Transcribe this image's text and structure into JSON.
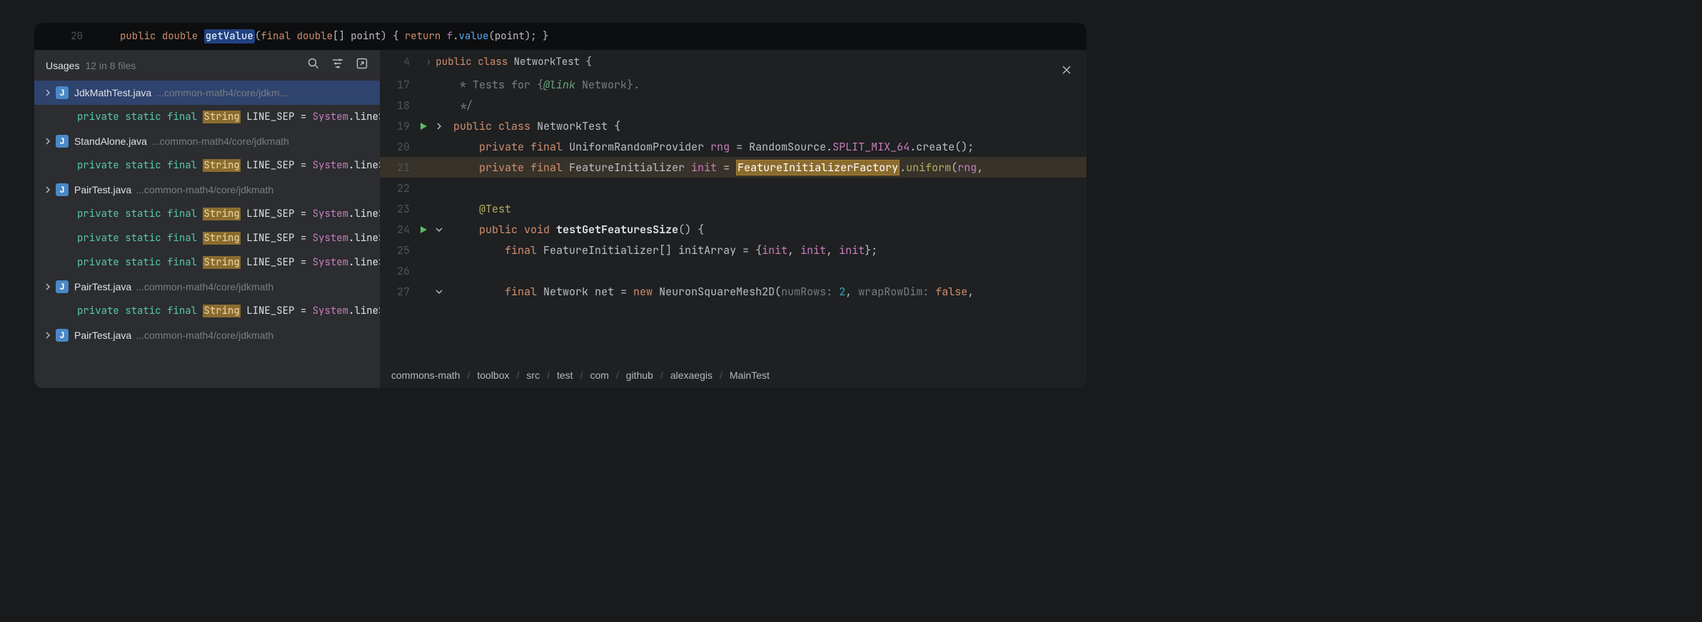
{
  "topLine": {
    "number": "20",
    "tokens": [
      {
        "t": "public",
        "c": "kw"
      },
      {
        "t": " "
      },
      {
        "t": "double",
        "c": "kw"
      },
      {
        "t": " "
      },
      {
        "t": "getValue",
        "c": "hl-blue"
      },
      {
        "t": "(",
        "c": "punc"
      },
      {
        "t": "final",
        "c": "kw"
      },
      {
        "t": " "
      },
      {
        "t": "double",
        "c": "kw"
      },
      {
        "t": "[] ",
        "c": "punc"
      },
      {
        "t": "point",
        "c": "ident"
      },
      {
        "t": ") { ",
        "c": "punc"
      },
      {
        "t": "return",
        "c": "kw"
      },
      {
        "t": " "
      },
      {
        "t": "f",
        "c": "type"
      },
      {
        "t": ".",
        "c": "punc"
      },
      {
        "t": "value",
        "c": "method-call"
      },
      {
        "t": "(",
        "c": "punc"
      },
      {
        "t": "point",
        "c": "ident"
      },
      {
        "t": "); }",
        "c": "punc"
      }
    ]
  },
  "usages": {
    "title": "Usages",
    "count": "12 in 8 files",
    "items": [
      {
        "kind": "file",
        "indent": 12,
        "chevron": true,
        "selected": true,
        "name": "JdkMathTest.java",
        "path": "...common-math4/core/jdkm..."
      },
      {
        "kind": "code",
        "indent": 60,
        "tokens": [
          {
            "t": "private ",
            "c": "cs-kw-pv"
          },
          {
            "t": "static ",
            "c": "cs-kw-pv"
          },
          {
            "t": "final ",
            "c": "cs-kw-pv"
          },
          {
            "t": "String",
            "c": "hl-amber"
          },
          {
            "t": " LINE_SEP ",
            "c": "cs-id"
          },
          {
            "t": "= ",
            "c": "cs-id"
          },
          {
            "t": "System",
            "c": "cs-type"
          },
          {
            "t": ".",
            "c": "cs-id"
          },
          {
            "t": "lineS",
            "c": "cs-id"
          }
        ]
      },
      {
        "kind": "file",
        "indent": 12,
        "chevron": true,
        "name": "StandAlone.java",
        "path": "...common-math4/core/jdkmath"
      },
      {
        "kind": "code",
        "indent": 60,
        "tokens": [
          {
            "t": "private ",
            "c": "cs-kw-pv"
          },
          {
            "t": "static ",
            "c": "cs-kw-pv"
          },
          {
            "t": "final ",
            "c": "cs-kw-pv"
          },
          {
            "t": "String",
            "c": "hl-amber"
          },
          {
            "t": " LINE_SEP ",
            "c": "cs-id"
          },
          {
            "t": "= ",
            "c": "cs-id"
          },
          {
            "t": "System",
            "c": "cs-type"
          },
          {
            "t": ".",
            "c": "cs-id"
          },
          {
            "t": "lineS",
            "c": "cs-id"
          }
        ]
      },
      {
        "kind": "file",
        "indent": 12,
        "chevron": true,
        "name": "PairTest.java",
        "path": "...common-math4/core/jdkmath"
      },
      {
        "kind": "code",
        "indent": 60,
        "tokens": [
          {
            "t": "private ",
            "c": "cs-kw-pv"
          },
          {
            "t": "static ",
            "c": "cs-kw-pv"
          },
          {
            "t": "final ",
            "c": "cs-kw-pv"
          },
          {
            "t": "String",
            "c": "hl-amber"
          },
          {
            "t": " LINE_SEP ",
            "c": "cs-id"
          },
          {
            "t": "= ",
            "c": "cs-id"
          },
          {
            "t": "System",
            "c": "cs-type"
          },
          {
            "t": ".",
            "c": "cs-id"
          },
          {
            "t": "lineS",
            "c": "cs-id"
          }
        ]
      },
      {
        "kind": "code",
        "indent": 60,
        "tokens": [
          {
            "t": "private ",
            "c": "cs-kw-pv"
          },
          {
            "t": "static ",
            "c": "cs-kw-pv"
          },
          {
            "t": "final ",
            "c": "cs-kw-pv"
          },
          {
            "t": "String",
            "c": "hl-amber"
          },
          {
            "t": " LINE_SEP ",
            "c": "cs-id"
          },
          {
            "t": "= ",
            "c": "cs-id"
          },
          {
            "t": "System",
            "c": "cs-type"
          },
          {
            "t": ".",
            "c": "cs-id"
          },
          {
            "t": "lineS",
            "c": "cs-id"
          }
        ]
      },
      {
        "kind": "code",
        "indent": 60,
        "tokens": [
          {
            "t": "private ",
            "c": "cs-kw-pv"
          },
          {
            "t": "static ",
            "c": "cs-kw-pv"
          },
          {
            "t": "final ",
            "c": "cs-kw-pv"
          },
          {
            "t": "String",
            "c": "hl-amber"
          },
          {
            "t": " LINE_SEP ",
            "c": "cs-id"
          },
          {
            "t": "= ",
            "c": "cs-id"
          },
          {
            "t": "System",
            "c": "cs-type"
          },
          {
            "t": ".",
            "c": "cs-id"
          },
          {
            "t": "lineS",
            "c": "cs-id"
          }
        ]
      },
      {
        "kind": "file",
        "indent": 12,
        "chevron": true,
        "name": "PairTest.java",
        "path": "...common-math4/core/jdkmath"
      },
      {
        "kind": "code",
        "indent": 60,
        "tokens": [
          {
            "t": "private ",
            "c": "cs-kw-pv"
          },
          {
            "t": "static ",
            "c": "cs-kw-pv"
          },
          {
            "t": "final ",
            "c": "cs-kw-pv"
          },
          {
            "t": "String",
            "c": "hl-amber"
          },
          {
            "t": " LINE_SEP ",
            "c": "cs-id"
          },
          {
            "t": "= ",
            "c": "cs-id"
          },
          {
            "t": "System",
            "c": "cs-type"
          },
          {
            "t": ".",
            "c": "cs-id"
          },
          {
            "t": "lineS",
            "c": "cs-id"
          }
        ]
      },
      {
        "kind": "file",
        "indent": 12,
        "chevron": true,
        "name": "PairTest.java",
        "path": "...common-math4/core/jdkmath"
      }
    ]
  },
  "preview": {
    "crumbTop": {
      "ln": "4",
      "text": "public class NetworkTest {"
    },
    "lines": [
      {
        "ln": "17",
        "run": "",
        "fold": "",
        "tokens": [
          {
            "t": "  * Tests for {",
            "c": "comment"
          },
          {
            "t": "@link",
            "c": "doc-tag"
          },
          {
            "t": " ",
            "c": "comment"
          },
          {
            "t": "Network",
            "c": "comment"
          },
          {
            "t": "}.",
            "c": "comment"
          }
        ]
      },
      {
        "ln": "18",
        "run": "",
        "fold": "",
        "tokens": [
          {
            "t": "  */",
            "c": "comment"
          }
        ]
      },
      {
        "ln": "19",
        "run": "play",
        "fold": "right",
        "tokens": [
          {
            "t": " ",
            "c": ""
          },
          {
            "t": "public",
            "c": "kw"
          },
          {
            "t": " ",
            "c": ""
          },
          {
            "t": "class",
            "c": "kw"
          },
          {
            "t": " ",
            "c": ""
          },
          {
            "t": "NetworkTest",
            "c": "ident"
          },
          {
            "t": " {",
            "c": "punc"
          }
        ]
      },
      {
        "ln": "20",
        "run": "",
        "fold": "",
        "tokens": [
          {
            "t": "     ",
            "c": ""
          },
          {
            "t": "private",
            "c": "kw"
          },
          {
            "t": " ",
            "c": ""
          },
          {
            "t": "final",
            "c": "kw"
          },
          {
            "t": " ",
            "c": ""
          },
          {
            "t": "UniformRandomProvider",
            "c": "ident"
          },
          {
            "t": " ",
            "c": ""
          },
          {
            "t": "rng",
            "c": "type"
          },
          {
            "t": " = ",
            "c": "punc"
          },
          {
            "t": "RandomSource",
            "c": "ident"
          },
          {
            "t": ".",
            "c": "punc"
          },
          {
            "t": "SPLIT_MIX_64",
            "c": "type"
          },
          {
            "t": ".create();",
            "c": "punc"
          }
        ]
      },
      {
        "ln": "21",
        "hl": true,
        "run": "",
        "fold": "",
        "tokens": [
          {
            "t": "     ",
            "c": ""
          },
          {
            "t": "private",
            "c": "kw"
          },
          {
            "t": " ",
            "c": ""
          },
          {
            "t": "final",
            "c": "kw"
          },
          {
            "t": " ",
            "c": ""
          },
          {
            "t": "FeatureInitializer",
            "c": "ident"
          },
          {
            "t": " ",
            "c": ""
          },
          {
            "t": "init",
            "c": "type"
          },
          {
            "t": " = ",
            "c": "punc"
          },
          {
            "t": "FeatureInitializerFactory",
            "c": "hl-amber-box"
          },
          {
            "t": ".",
            "c": "punc"
          },
          {
            "t": "uniform",
            "c": "str-anno"
          },
          {
            "t": "(",
            "c": "punc"
          },
          {
            "t": "rng",
            "c": "type"
          },
          {
            "t": ",",
            "c": "punc"
          }
        ]
      },
      {
        "ln": "22",
        "run": "",
        "fold": "",
        "tokens": []
      },
      {
        "ln": "23",
        "run": "",
        "fold": "",
        "tokens": [
          {
            "t": "     ",
            "c": ""
          },
          {
            "t": "@Test",
            "c": "str-anno"
          }
        ]
      },
      {
        "ln": "24",
        "run": "play",
        "fold": "down",
        "tokens": [
          {
            "t": "     ",
            "c": ""
          },
          {
            "t": "public",
            "c": "kw"
          },
          {
            "t": " ",
            "c": ""
          },
          {
            "t": "void",
            "c": "kw"
          },
          {
            "t": " ",
            "c": ""
          },
          {
            "t": "testGetFeaturesSize",
            "c": "bold-id"
          },
          {
            "t": "() {",
            "c": "punc"
          }
        ]
      },
      {
        "ln": "25",
        "run": "",
        "fold": "",
        "tokens": [
          {
            "t": "         ",
            "c": ""
          },
          {
            "t": "final",
            "c": "kw"
          },
          {
            "t": " ",
            "c": ""
          },
          {
            "t": "FeatureInitializer",
            "c": "ident"
          },
          {
            "t": "[] ",
            "c": "punc"
          },
          {
            "t": "initArray",
            "c": "ident"
          },
          {
            "t": " = {",
            "c": "punc"
          },
          {
            "t": "init",
            "c": "type"
          },
          {
            "t": ", ",
            "c": "punc"
          },
          {
            "t": "init",
            "c": "type"
          },
          {
            "t": ", ",
            "c": "punc"
          },
          {
            "t": "init",
            "c": "type"
          },
          {
            "t": "};",
            "c": "punc"
          }
        ]
      },
      {
        "ln": "26",
        "run": "",
        "fold": "",
        "tokens": []
      },
      {
        "ln": "27",
        "run": "",
        "fold": "down",
        "tokens": [
          {
            "t": "         ",
            "c": ""
          },
          {
            "t": "final",
            "c": "kw"
          },
          {
            "t": " ",
            "c": ""
          },
          {
            "t": "Network",
            "c": "ident"
          },
          {
            "t": " ",
            "c": ""
          },
          {
            "t": "net",
            "c": "ident"
          },
          {
            "t": " = ",
            "c": "punc"
          },
          {
            "t": "new",
            "c": "kw"
          },
          {
            "t": " ",
            "c": ""
          },
          {
            "t": "NeuronSquareMesh2D",
            "c": "ident"
          },
          {
            "t": "(",
            "c": "punc"
          },
          {
            "t": "numRows: ",
            "c": "param-hint"
          },
          {
            "t": "2",
            "c": "num"
          },
          {
            "t": ", ",
            "c": "punc"
          },
          {
            "t": "wrapRowDim: ",
            "c": "param-hint"
          },
          {
            "t": "false",
            "c": "kw"
          },
          {
            "t": ",",
            "c": "punc"
          }
        ]
      }
    ],
    "breadcrumb": [
      "commons-math",
      "toolbox",
      "src",
      "test",
      "com",
      "github",
      "alexaegis",
      "MainTest"
    ]
  }
}
